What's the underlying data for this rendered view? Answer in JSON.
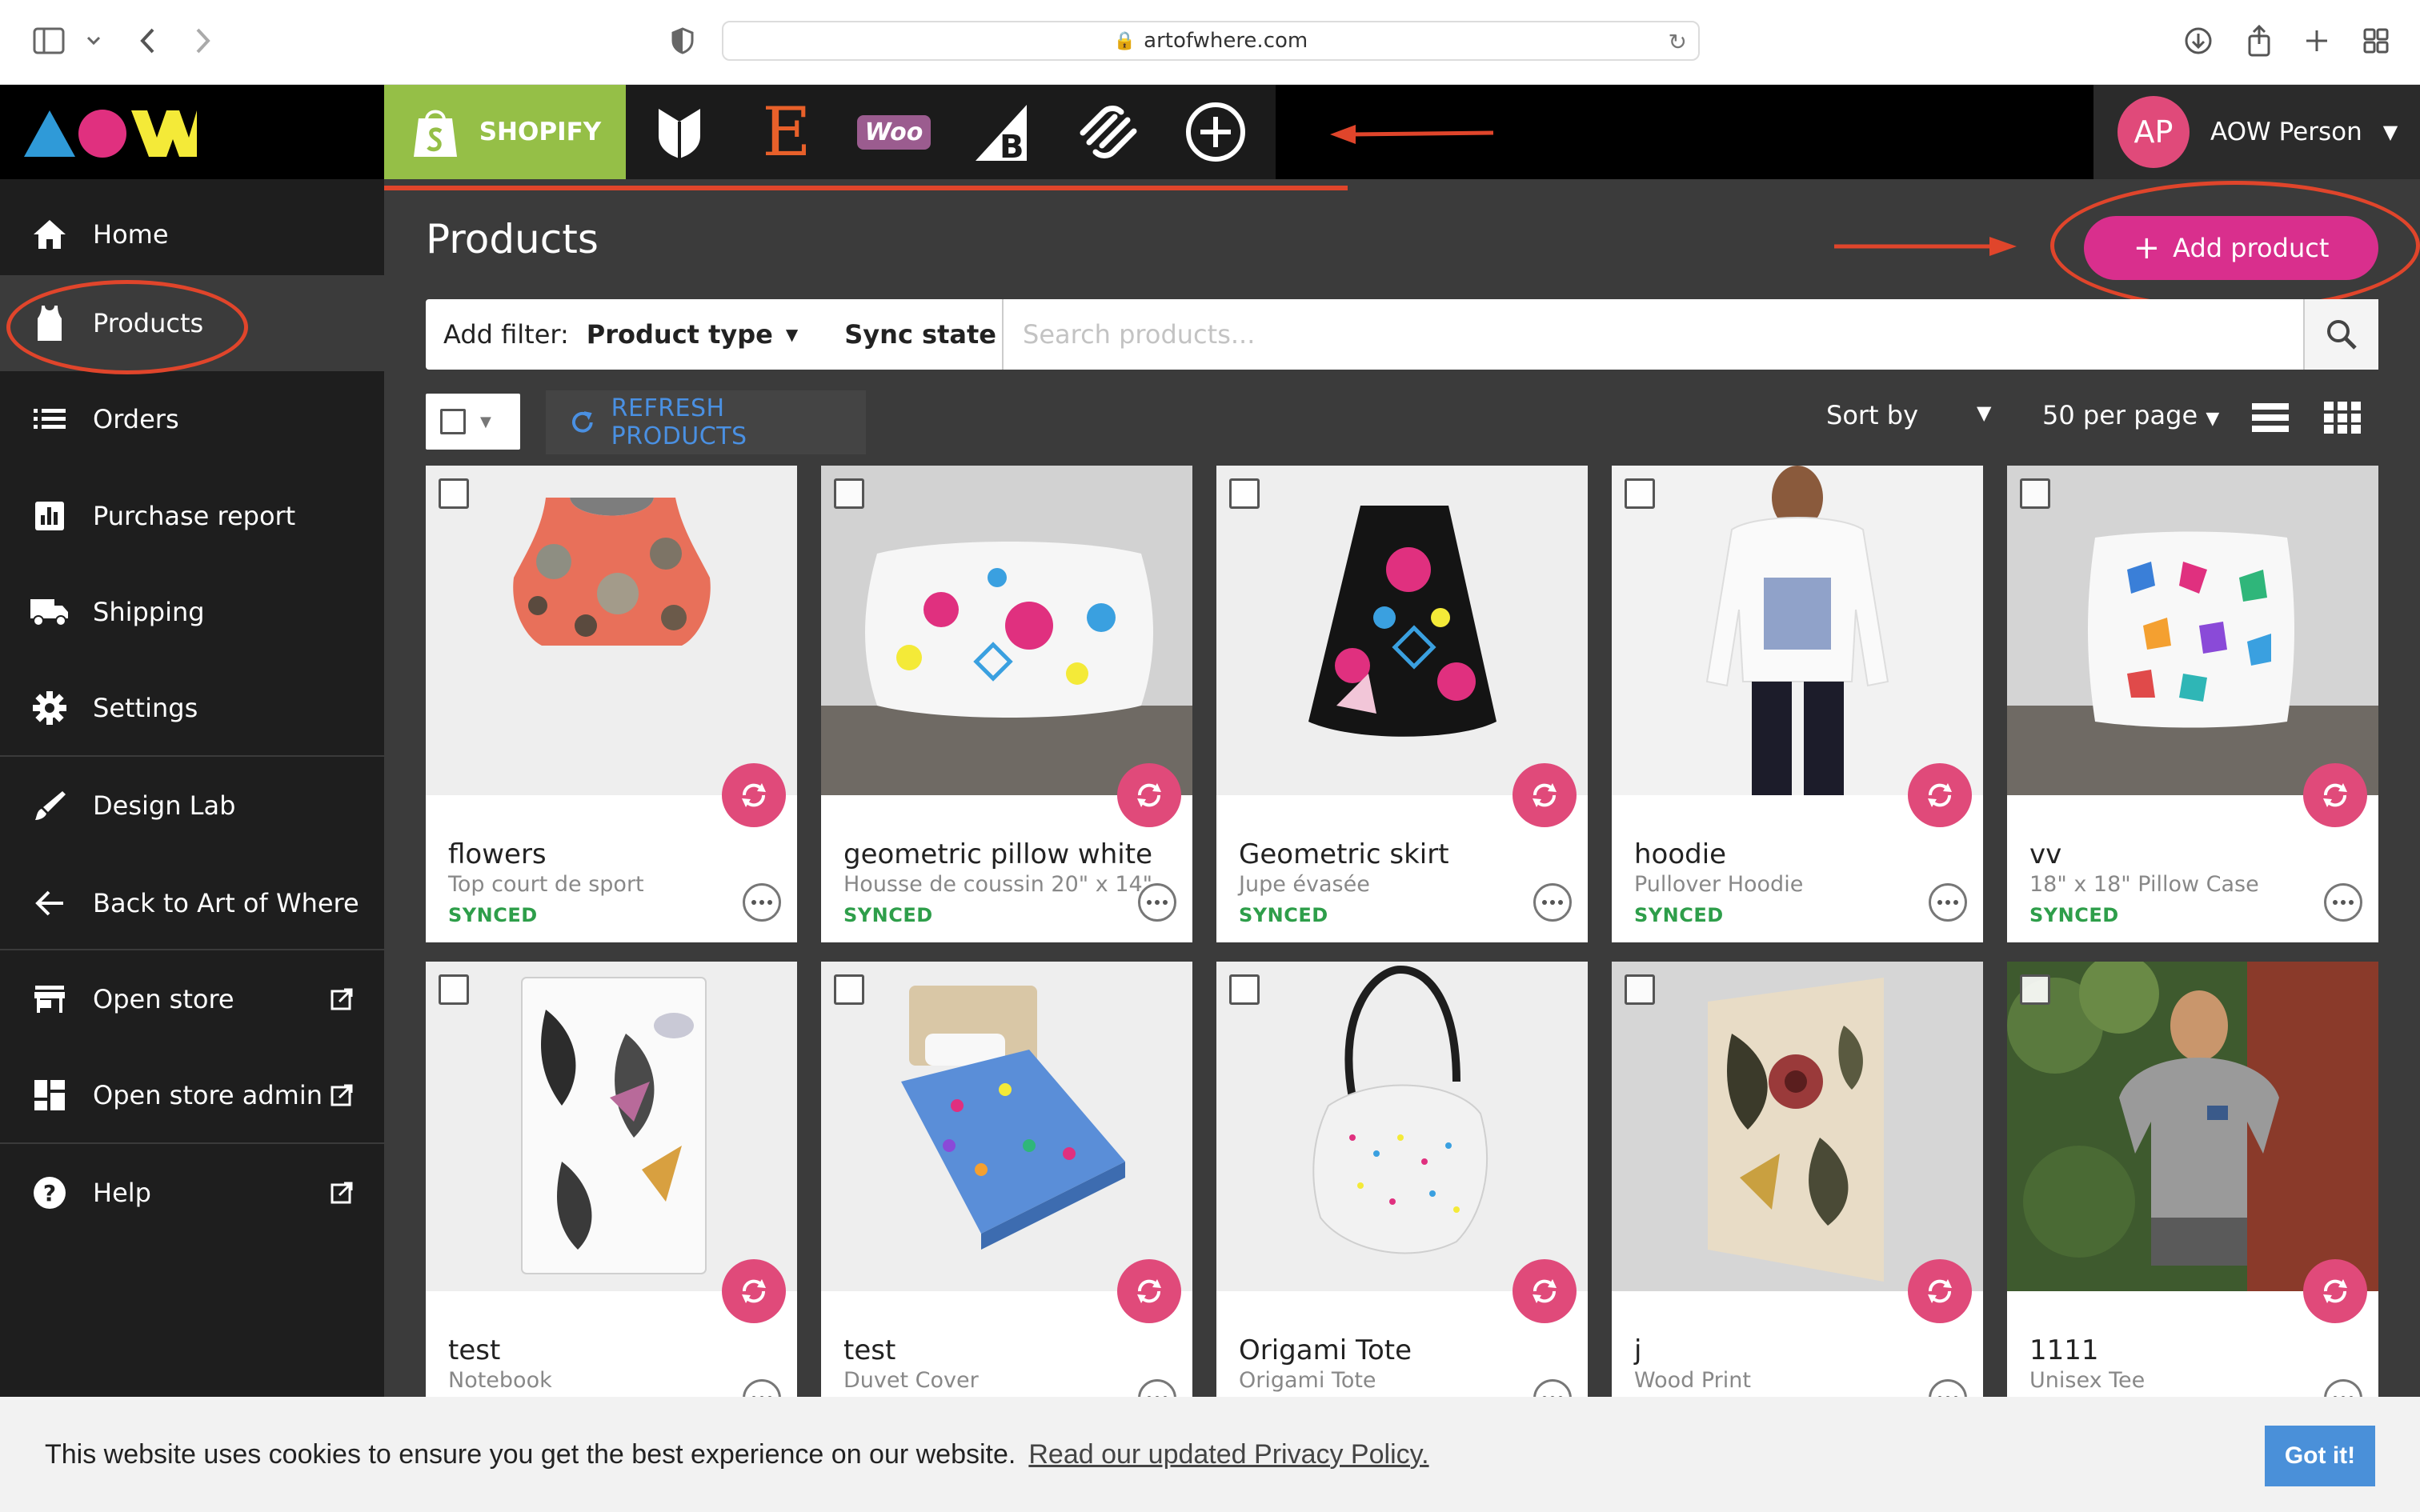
{
  "browser": {
    "url": "artofwhere.com"
  },
  "topbar": {
    "platforms": [
      {
        "name": "shopify",
        "label": "SHOPIFY"
      },
      {
        "name": "bigcartel",
        "label": ""
      },
      {
        "name": "etsy",
        "label": "E"
      },
      {
        "name": "woocommerce",
        "label": "Woo"
      },
      {
        "name": "bigcommerce",
        "label": ""
      },
      {
        "name": "squarespace",
        "label": ""
      },
      {
        "name": "add-platform",
        "label": ""
      }
    ],
    "user": {
      "initials": "AP",
      "name": "AOW Person"
    }
  },
  "sidebar": {
    "items": [
      {
        "label": "Home",
        "icon": "home-icon"
      },
      {
        "label": "Products",
        "icon": "tank-top-icon",
        "active": true
      },
      {
        "label": "Orders",
        "icon": "list-icon"
      },
      {
        "label": "Purchase report",
        "icon": "report-icon"
      },
      {
        "label": "Shipping",
        "icon": "truck-icon"
      },
      {
        "label": "Settings",
        "icon": "gear-icon"
      },
      {
        "label": "Design Lab",
        "icon": "brush-icon"
      },
      {
        "label": "Back to Art of Where",
        "icon": "arrow-left-icon"
      },
      {
        "label": "Open store",
        "icon": "store-icon",
        "external": true
      },
      {
        "label": "Open store admin",
        "icon": "dashboard-icon",
        "external": true
      },
      {
        "label": "Help",
        "icon": "help-icon",
        "external": true
      }
    ]
  },
  "main": {
    "title": "Products",
    "add_button": "Add product",
    "filter": {
      "label": "Add filter:",
      "product_type": "Product type",
      "sync_state": "Sync state",
      "search_placeholder": "Search products..."
    },
    "toolbar": {
      "refresh": "REFRESH PRODUCTS",
      "sort_by": "Sort by",
      "per_page": "50 per page"
    },
    "products": [
      {
        "title": "flowers",
        "subtitle": "Top court de sport",
        "status": "SYNCED",
        "image": "crop top"
      },
      {
        "title": "geometric pillow white",
        "subtitle": "Housse de coussin 20\" x 14\"",
        "status": "SYNCED",
        "image": "pillow"
      },
      {
        "title": "Geometric skirt",
        "subtitle": "Jupe évasée",
        "status": "SYNCED",
        "image": "skirt"
      },
      {
        "title": "hoodie",
        "subtitle": "Pullover Hoodie",
        "status": "SYNCED",
        "image": "hoodie"
      },
      {
        "title": "vv",
        "subtitle": "18\" x 18\" Pillow Case",
        "status": "SYNCED",
        "image": "pillow case"
      },
      {
        "title": "test",
        "subtitle": "Notebook",
        "status": "",
        "image": "notebook"
      },
      {
        "title": "test",
        "subtitle": "Duvet Cover",
        "status": "",
        "image": "duvet"
      },
      {
        "title": "Origami Tote",
        "subtitle": "Origami Tote",
        "status": "",
        "image": "tote"
      },
      {
        "title": "j",
        "subtitle": "Wood Print",
        "status": "",
        "image": "wood print"
      },
      {
        "title": "1111",
        "subtitle": "Unisex Tee",
        "status": "",
        "image": "tee"
      }
    ]
  },
  "cookie": {
    "text": "This website uses cookies to ensure you get the best experience on our website.",
    "link": "Read our updated Privacy Policy.",
    "button": "Got it!"
  },
  "colors": {
    "accent_pink": "#d92f8d",
    "shopify_green": "#95bf47",
    "synced_green": "#2e9e4a",
    "annotation_red": "#e0452b",
    "link_blue": "#4a90e2"
  }
}
